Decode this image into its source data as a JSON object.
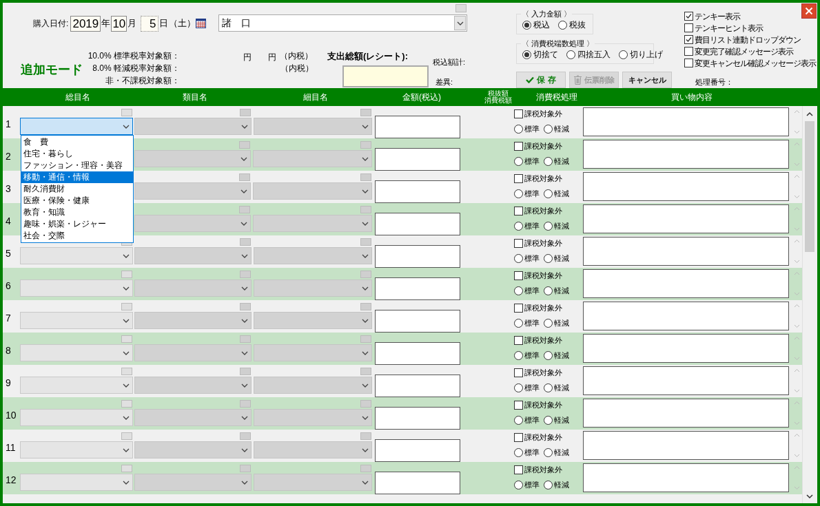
{
  "purchase_date": {
    "label": "購入日付:",
    "year": "2019",
    "year_unit": "年",
    "month": "10",
    "month_unit": "月",
    "day": "5",
    "day_unit": "日",
    "weekday": "（土）"
  },
  "store": {
    "value": "諸　口"
  },
  "mode": "追加モード",
  "tax_bases": [
    {
      "label": "10.0% 標準税率対象額：",
      "amount_unit": "円",
      "tax_unit": "円",
      "tax_note": "（内税）"
    },
    {
      "label": "8.0% 軽減税率対象額：",
      "tax_note": "（内税）"
    },
    {
      "label": "非・不課税対象額："
    }
  ],
  "receipt_total": {
    "label": "支出総額(レシート):"
  },
  "totals": [
    {
      "label": "税込額計:"
    },
    {
      "label": "差異:"
    }
  ],
  "input_amount": {
    "title": "〈 入力金額 〉",
    "options": [
      {
        "label": "税込",
        "selected": true
      },
      {
        "label": "税抜",
        "selected": false
      }
    ]
  },
  "rounding": {
    "title": "〈 消費税端数処理 〉",
    "options": [
      {
        "label": "切捨て",
        "selected": true
      },
      {
        "label": "四捨五入",
        "selected": false
      },
      {
        "label": "切り上げ",
        "selected": false
      }
    ]
  },
  "buttons": [
    {
      "label": "保 存",
      "kind": "save",
      "disabled": false
    },
    {
      "label": "伝票削除",
      "kind": "delete",
      "disabled": true
    },
    {
      "label": "キャンセル",
      "kind": "cancel",
      "disabled": false
    }
  ],
  "settings": [
    {
      "label": "テンキー表示",
      "checked": true
    },
    {
      "label": "テンキーヒント表示",
      "checked": false
    },
    {
      "label": "費目リスト連動ドロップダウン",
      "checked": true
    },
    {
      "label": "変更完了確認メッセージ表示",
      "checked": false
    },
    {
      "label": "変更キャンセル確認メッセージ表示",
      "checked": false
    }
  ],
  "process_number": {
    "label": "処理番号："
  },
  "columns": [
    {
      "lines": [
        "総目名"
      ]
    },
    {
      "lines": [
        "類目名"
      ]
    },
    {
      "lines": [
        "細目名"
      ]
    },
    {
      "lines": [
        "金額(税込)"
      ]
    },
    {
      "lines": [
        "税抜額",
        "消費税額"
      ]
    },
    {
      "lines": [
        "消費税処理"
      ]
    },
    {
      "lines": [
        "買い物内容"
      ]
    }
  ],
  "rows": [
    {
      "number": "1",
      "shaded": false,
      "focused": true,
      "covered": false,
      "tax_exempt_label": "課税対象外",
      "tax_exempt": false,
      "rates": [
        {
          "label": "標準",
          "selected": false
        },
        {
          "label": "軽減",
          "selected": false
        }
      ]
    },
    {
      "number": "2",
      "shaded": true,
      "covered": true,
      "tax_exempt_label": "課税対象外",
      "tax_exempt": false,
      "rates": [
        {
          "label": "標準",
          "selected": false
        },
        {
          "label": "軽減",
          "selected": false
        }
      ]
    },
    {
      "number": "3",
      "shaded": false,
      "covered": true,
      "tax_exempt_label": "課税対象外",
      "tax_exempt": false,
      "rates": [
        {
          "label": "標準",
          "selected": false
        },
        {
          "label": "軽減",
          "selected": false
        }
      ]
    },
    {
      "number": "4",
      "shaded": true,
      "covered": true,
      "tax_exempt_label": "課税対象外",
      "tax_exempt": false,
      "rates": [
        {
          "label": "標準",
          "selected": false
        },
        {
          "label": "軽減",
          "selected": false
        }
      ]
    },
    {
      "number": "5",
      "shaded": false,
      "focused": false,
      "covered": false,
      "tax_exempt_label": "課税対象外",
      "tax_exempt": false,
      "rates": [
        {
          "label": "標準",
          "selected": false
        },
        {
          "label": "軽減",
          "selected": false
        }
      ]
    },
    {
      "number": "6",
      "shaded": true,
      "focused": false,
      "covered": false,
      "tax_exempt_label": "課税対象外",
      "tax_exempt": false,
      "rates": [
        {
          "label": "標準",
          "selected": false
        },
        {
          "label": "軽減",
          "selected": false
        }
      ]
    },
    {
      "number": "7",
      "shaded": false,
      "focused": false,
      "covered": false,
      "tax_exempt_label": "課税対象外",
      "tax_exempt": false,
      "rates": [
        {
          "label": "標準",
          "selected": false
        },
        {
          "label": "軽減",
          "selected": false
        }
      ]
    },
    {
      "number": "8",
      "shaded": true,
      "focused": false,
      "covered": false,
      "tax_exempt_label": "課税対象外",
      "tax_exempt": false,
      "rates": [
        {
          "label": "標準",
          "selected": false
        },
        {
          "label": "軽減",
          "selected": false
        }
      ]
    },
    {
      "number": "9",
      "shaded": false,
      "focused": false,
      "covered": false,
      "tax_exempt_label": "課税対象外",
      "tax_exempt": false,
      "rates": [
        {
          "label": "標準",
          "selected": false
        },
        {
          "label": "軽減",
          "selected": false
        }
      ]
    },
    {
      "number": "10",
      "shaded": true,
      "focused": false,
      "covered": false,
      "tax_exempt_label": "課税対象外",
      "tax_exempt": false,
      "rates": [
        {
          "label": "標準",
          "selected": false
        },
        {
          "label": "軽減",
          "selected": false
        }
      ]
    },
    {
      "number": "11",
      "shaded": false,
      "focused": false,
      "covered": false,
      "tax_exempt_label": "課税対象外",
      "tax_exempt": false,
      "rates": [
        {
          "label": "標準",
          "selected": false
        },
        {
          "label": "軽減",
          "selected": false
        }
      ]
    },
    {
      "number": "12",
      "shaded": true,
      "focused": false,
      "covered": false,
      "tax_exempt_label": "課税対象外",
      "tax_exempt": false,
      "rates": [
        {
          "label": "標準",
          "selected": false
        },
        {
          "label": "軽減",
          "selected": false
        }
      ]
    }
  ],
  "dropdown": {
    "items": [
      {
        "label": "食　費",
        "selected": false
      },
      {
        "label": "住宅・暮らし",
        "selected": false
      },
      {
        "label": "ファッション・理容・美容",
        "selected": false
      },
      {
        "label": "移動・通信・情報",
        "selected": true
      },
      {
        "label": "耐久消費財",
        "selected": false
      },
      {
        "label": "医療・保険・健康",
        "selected": false
      },
      {
        "label": "教育・知識",
        "selected": false
      },
      {
        "label": "趣味・娯楽・レジャー",
        "selected": false
      },
      {
        "label": "社会・交際",
        "selected": false
      }
    ]
  }
}
